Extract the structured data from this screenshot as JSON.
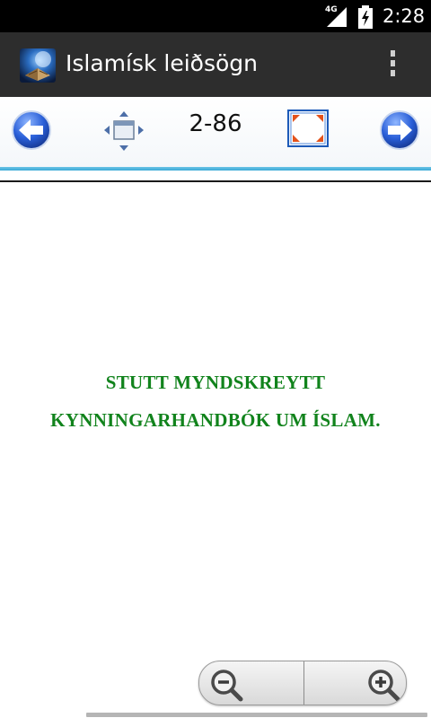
{
  "status_bar": {
    "network": "4G",
    "time": "2:28",
    "icons": [
      "signal-icon",
      "battery-charging-icon"
    ]
  },
  "action_bar": {
    "title": "Islamísk leiðsögn",
    "icons": [
      "app-icon",
      "overflow-menu-icon"
    ]
  },
  "toolbar": {
    "page": "2-86",
    "icons": [
      "arrow-left-icon",
      "fit-page-icon",
      "fullscreen-icon",
      "arrow-right-icon"
    ]
  },
  "document": {
    "line1": "STUTT MYNDSKREYTT",
    "line2": "KYNNINGARHANDBÓK UM ÍSLAM.",
    "text_color": "#11831c"
  },
  "zoom": {
    "icons": [
      "zoom-out-icon",
      "zoom-in-icon"
    ]
  },
  "colors": {
    "accent_line": "#3aa9d6",
    "action_bar": "#2d2d2d",
    "status_bar": "#000000"
  }
}
